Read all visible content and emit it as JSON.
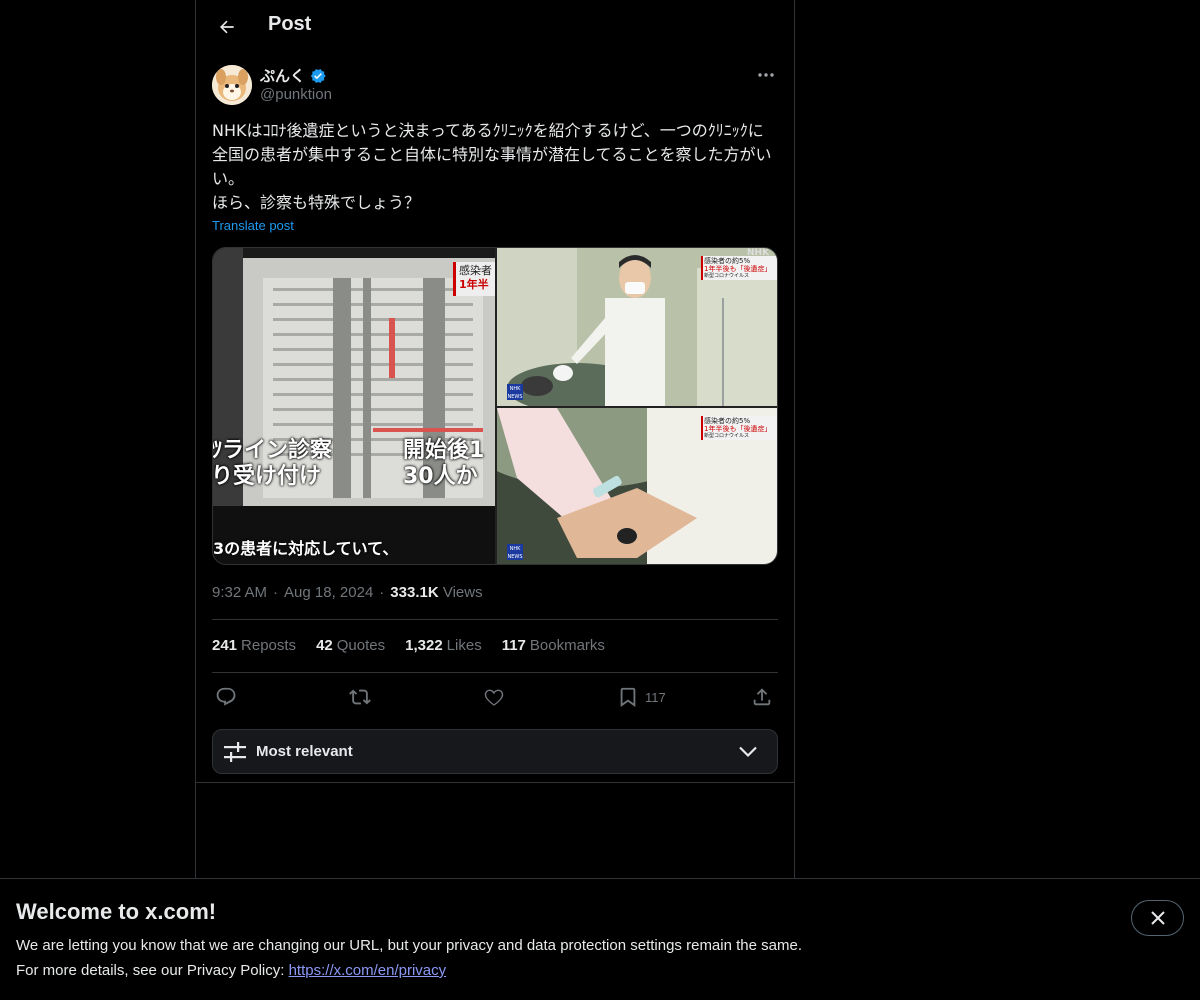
{
  "header": {
    "title": "Post",
    "back_icon": "arrow-left-icon"
  },
  "author": {
    "display_name": "ぷんく",
    "handle": "@punktion",
    "verified": true,
    "verified_color": "#1d9bf0"
  },
  "post": {
    "text": "NHKはｺﾛﾅ後遺症というと決まってあるｸﾘﾆｯｸを紹介するけど、一つのｸﾘﾆｯｸに全国の患者が集中すること自体に特別な事情が潜在してることを察した方がいい。\nほら、診察も特殊でしょう？",
    "translate_label": "Translate post",
    "time": "9:32 AM",
    "date": "Aug 18, 2024",
    "views_count": "333.1K",
    "views_label": "Views"
  },
  "media": {
    "left": {
      "caption_line1_a": "ﾂライン診察",
      "caption_line2_a": "り受け付け",
      "caption_line1_b": "開始後1",
      "caption_line2_b": "30人か",
      "bottom_caption": "3の患者に対応していて、",
      "badge_line1": "感染者",
      "badge_line2": "1年半"
    },
    "top_right": {
      "badge_line1": "感染者の約5%",
      "badge_line2": "1年半後も「後遺症」",
      "badge_line3": "新型コロナウイルス",
      "corner_text": "NHK"
    },
    "bottom_right": {
      "badge_line1": "感染者の約5%",
      "badge_line2": "1年半後も「後遺症」",
      "badge_line3": "新型コロナウイルス"
    },
    "logo_text": "NHK NEWS"
  },
  "stats": {
    "reposts_count": "241",
    "reposts_label": "Reposts",
    "quotes_count": "42",
    "quotes_label": "Quotes",
    "likes_count": "1,322",
    "likes_label": "Likes",
    "bookmarks_count": "117",
    "bookmarks_label": "Bookmarks"
  },
  "actions": {
    "reply_icon": "reply-icon",
    "repost_icon": "repost-icon",
    "like_icon": "heart-icon",
    "bookmark_icon": "bookmark-icon",
    "bookmark_count": "117",
    "share_icon": "share-icon"
  },
  "sort": {
    "label": "Most relevant"
  },
  "banner": {
    "title": "Welcome to x.com!",
    "line1": "We are letting you know that we are changing our URL, but your privacy and data protection settings remain the same.",
    "line2_prefix": "For more details, see our Privacy Policy: ",
    "link_text": "https://x.com/en/privacy"
  }
}
